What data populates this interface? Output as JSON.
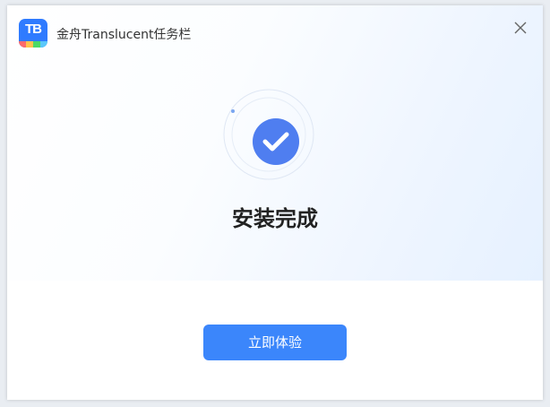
{
  "window": {
    "app_icon_text": "TB",
    "title": "金舟Translucent任务栏"
  },
  "status": {
    "title": "安装完成"
  },
  "actions": {
    "primary_label": "立即体验"
  },
  "icons": {
    "close": "close-icon",
    "success": "check-circle-icon"
  },
  "colors": {
    "accent": "#3b86fb",
    "logo_stripes": [
      "#ff6b6b",
      "#ffc34d",
      "#4cd964",
      "#5ac8fa"
    ]
  }
}
